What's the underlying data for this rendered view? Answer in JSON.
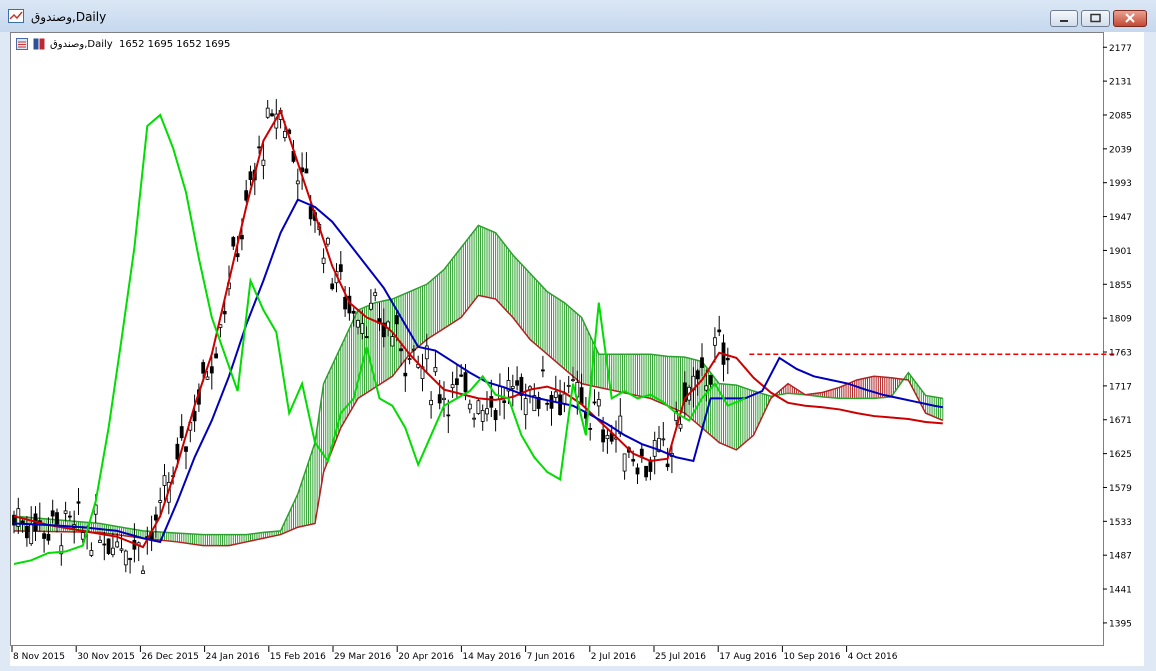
{
  "window": {
    "title": "وصندوق,Daily"
  },
  "header": {
    "symbol": "وصندوق,Daily",
    "ohlc": "1652 1695 1652 1695"
  },
  "chart_data": {
    "type": "line",
    "price_axis": {
      "ticks": [
        2177,
        2131,
        2085,
        2039,
        1993,
        1947,
        1901,
        1855,
        1809,
        1763,
        1717,
        1671,
        1625,
        1579,
        1533,
        1487,
        1441,
        1395
      ]
    },
    "time_axis": {
      "labels": [
        "8 Nov 2015",
        "30 Nov 2015",
        "26 Dec 2015",
        "24 Jan 2016",
        "15 Feb 2016",
        "29 Mar 2016",
        "20 Apr 2016",
        "14 May 2016",
        "7 Jun 2016",
        "2 Jul 2016",
        "25 Jul 2016",
        "17 Aug 2016",
        "10 Sep 2016",
        "4 Oct 2016"
      ]
    },
    "x_range": [
      0,
      218
    ],
    "y_range": [
      1365,
      2195
    ],
    "colors": {
      "tenkan": "#cc0000",
      "kijun": "#0000bb",
      "chikou": "#00dd00",
      "bull_cloud": "#2ca02c",
      "bear_cloud": "#b22222",
      "candle": "#000000"
    },
    "series": [
      {
        "key": "tenkan",
        "x": [
          0,
          8,
          16,
          24,
          30,
          34,
          38,
          42,
          46,
          50,
          54,
          58,
          62,
          66,
          70,
          74,
          78,
          82,
          86,
          88,
          92,
          96,
          100,
          104,
          108,
          112,
          116,
          120,
          124,
          128,
          132,
          136,
          140,
          144,
          148,
          152,
          156,
          160,
          164,
          168,
          172,
          176,
          180,
          184,
          188,
          192,
          196,
          200,
          204,
          208,
          212,
          216
        ],
        "values": [
          1540,
          1528,
          1520,
          1512,
          1498,
          1540,
          1610,
          1690,
          1760,
          1860,
          1960,
          2050,
          2090,
          2020,
          1950,
          1880,
          1830,
          1810,
          1800,
          1790,
          1760,
          1735,
          1712,
          1706,
          1700,
          1698,
          1702,
          1712,
          1716,
          1708,
          1692,
          1670,
          1648,
          1625,
          1615,
          1618,
          1700,
          1725,
          1762,
          1755,
          1728,
          1708,
          1694,
          1690,
          1688,
          1685,
          1680,
          1676,
          1674,
          1672,
          1668,
          1666
        ]
      },
      {
        "key": "kijun",
        "x": [
          0,
          8,
          16,
          24,
          30,
          34,
          38,
          42,
          46,
          50,
          54,
          58,
          62,
          66,
          70,
          74,
          78,
          82,
          86,
          90,
          94,
          98,
          102,
          106,
          110,
          114,
          118,
          122,
          126,
          130,
          134,
          138,
          142,
          146,
          150,
          154,
          158,
          162,
          166,
          170,
          174,
          178,
          182,
          186,
          190,
          194,
          198,
          202,
          206,
          210,
          214,
          216
        ],
        "values": [
          1530,
          1528,
          1525,
          1520,
          1510,
          1505,
          1560,
          1620,
          1670,
          1730,
          1800,
          1860,
          1925,
          1970,
          1960,
          1940,
          1910,
          1880,
          1850,
          1810,
          1770,
          1765,
          1750,
          1735,
          1722,
          1715,
          1706,
          1700,
          1695,
          1690,
          1678,
          1665,
          1650,
          1638,
          1630,
          1620,
          1615,
          1700,
          1700,
          1700,
          1710,
          1755,
          1740,
          1730,
          1725,
          1720,
          1712,
          1705,
          1700,
          1695,
          1690,
          1688
        ]
      },
      {
        "key": "chikou",
        "x": [
          0,
          4,
          8,
          12,
          16,
          19,
          22,
          25,
          28,
          31,
          34,
          37,
          40,
          43,
          46,
          49,
          52,
          55,
          58,
          61,
          64,
          67,
          70,
          73,
          76,
          79,
          82,
          85,
          88,
          91,
          94,
          97,
          100,
          103,
          106,
          109,
          112,
          115,
          118,
          121,
          124,
          127,
          130,
          133,
          136,
          139,
          142,
          145,
          148,
          151,
          154,
          157,
          160,
          163,
          166,
          170
        ],
        "values": [
          1475,
          1480,
          1490,
          1492,
          1500,
          1560,
          1660,
          1780,
          1905,
          2070,
          2085,
          2040,
          1980,
          1890,
          1810,
          1760,
          1710,
          1860,
          1820,
          1790,
          1680,
          1720,
          1640,
          1615,
          1680,
          1700,
          1770,
          1700,
          1690,
          1660,
          1610,
          1650,
          1690,
          1700,
          1710,
          1730,
          1705,
          1700,
          1650,
          1620,
          1600,
          1590,
          1720,
          1650,
          1830,
          1700,
          1710,
          1700,
          1705,
          1695,
          1680,
          1670,
          1700,
          1720,
          1690,
          1700
        ]
      }
    ],
    "cloud": {
      "x": [
        0,
        20,
        30,
        38,
        44,
        50,
        54,
        58,
        62,
        66,
        70,
        72,
        76,
        80,
        84,
        88,
        92,
        96,
        100,
        104,
        108,
        112,
        116,
        120,
        124,
        128,
        132,
        136,
        140,
        144,
        148,
        152,
        156,
        160,
        164,
        168,
        172,
        176,
        180,
        184,
        188,
        192,
        196,
        200,
        204,
        208,
        212,
        216
      ],
      "span_a": [
        1540,
        1530,
        1520,
        1517,
        1515,
        1515,
        1515,
        1518,
        1520,
        1570,
        1640,
        1720,
        1770,
        1820,
        1830,
        1835,
        1845,
        1855,
        1875,
        1905,
        1935,
        1925,
        1895,
        1870,
        1845,
        1830,
        1810,
        1760,
        1760,
        1760,
        1760,
        1757,
        1756,
        1750,
        1720,
        1718,
        1710,
        1703,
        1707,
        1705,
        1702,
        1700,
        1700,
        1700,
        1702,
        1735,
        1704,
        1700
      ],
      "span_b": [
        1520,
        1518,
        1510,
        1505,
        1500,
        1500,
        1505,
        1510,
        1515,
        1525,
        1530,
        1600,
        1660,
        1700,
        1715,
        1730,
        1760,
        1780,
        1795,
        1810,
        1840,
        1835,
        1810,
        1780,
        1760,
        1740,
        1720,
        1715,
        1710,
        1705,
        1700,
        1690,
        1680,
        1660,
        1640,
        1630,
        1650,
        1700,
        1720,
        1705,
        1708,
        1715,
        1725,
        1730,
        1728,
        1725,
        1680,
        1670
      ]
    },
    "resistance_line": {
      "value": 1760,
      "x_from": 171,
      "x_to": 256
    }
  }
}
